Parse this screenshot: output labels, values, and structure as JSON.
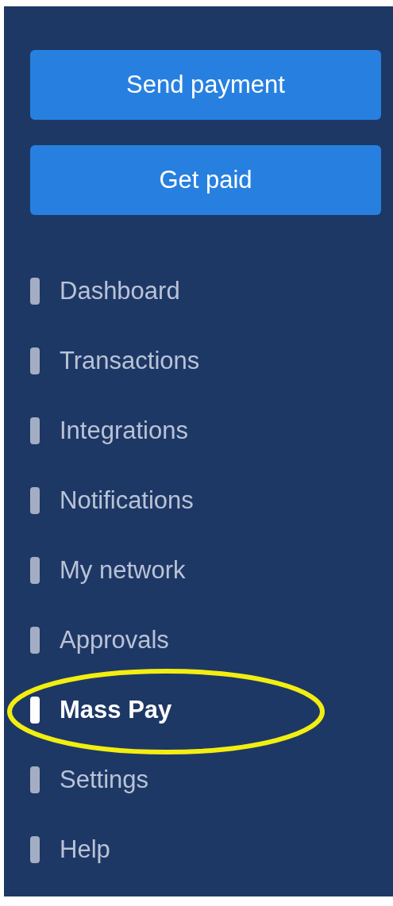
{
  "buttons": [
    {
      "label": "Send payment"
    },
    {
      "label": "Get paid"
    }
  ],
  "nav": [
    {
      "label": "Dashboard",
      "selected": false,
      "circled": false
    },
    {
      "label": "Transactions",
      "selected": false,
      "circled": false
    },
    {
      "label": "Integrations",
      "selected": false,
      "circled": false
    },
    {
      "label": "Notifications",
      "selected": false,
      "circled": false
    },
    {
      "label": "My network",
      "selected": false,
      "circled": false
    },
    {
      "label": "Approvals",
      "selected": false,
      "circled": false
    },
    {
      "label": "Mass Pay",
      "selected": true,
      "circled": true
    },
    {
      "label": "Settings",
      "selected": false,
      "circled": false
    },
    {
      "label": "Help",
      "selected": false,
      "circled": false
    }
  ]
}
